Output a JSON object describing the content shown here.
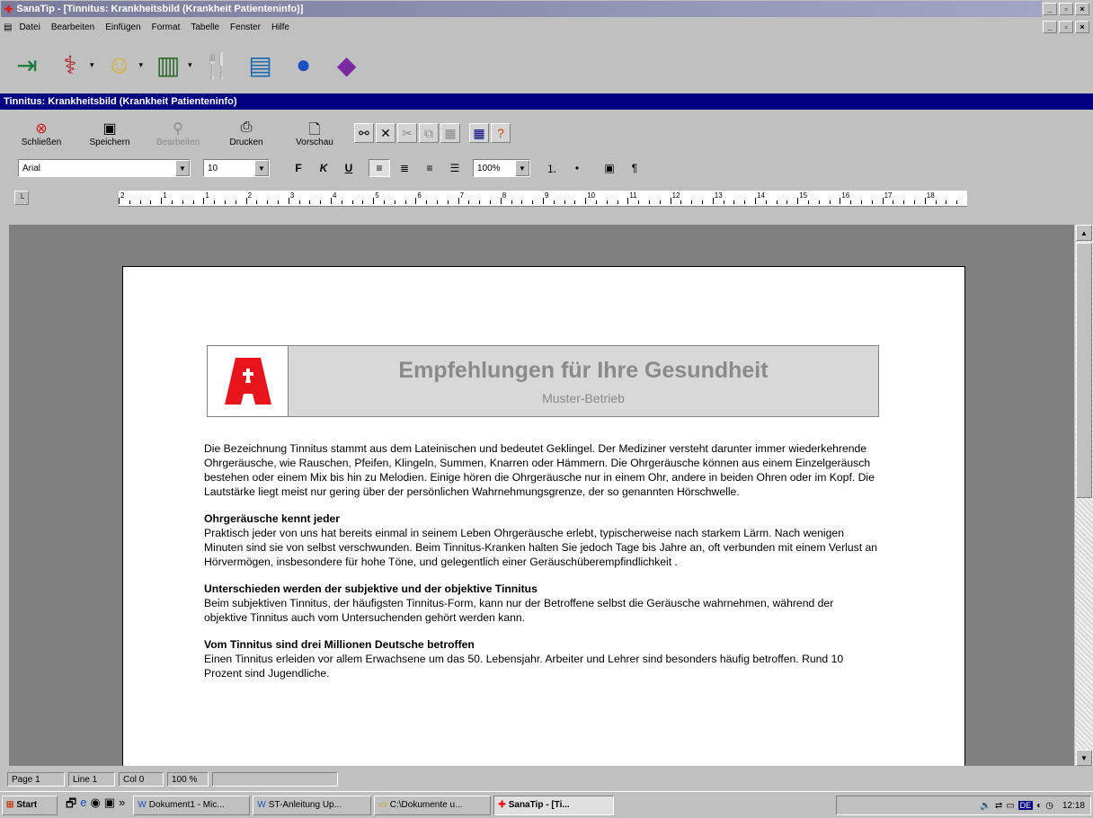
{
  "window": {
    "title": "SanaTip - [Tinnitus: Krankheitsbild (Krankheit Patienteninfo)]",
    "controls": [
      "_",
      "▫",
      "×"
    ]
  },
  "menu": [
    "Datei",
    "Bearbeiten",
    "Einfügen",
    "Format",
    "Tabelle",
    "Fenster",
    "Hilfe"
  ],
  "doc_window_title": "Tinnitus: Krankheitsbild (Krankheit Patienteninfo)",
  "toolbar": {
    "close": "Schließen",
    "save": "Speichern",
    "edit": "Bearbeiten",
    "print": "Drucken",
    "preview": "Vorschau"
  },
  "format": {
    "font": "Arial",
    "size": "10",
    "bold": "F",
    "italic": "K",
    "underline": "U",
    "zoom": "100%",
    "pilcrow": "¶"
  },
  "ruler": {
    "numbers": [
      "2",
      "1",
      "1",
      "2",
      "3",
      "4",
      "5",
      "6",
      "7",
      "8",
      "9",
      "10",
      "11",
      "12",
      "13",
      "14",
      "15",
      "16",
      "17",
      "18"
    ]
  },
  "banner": {
    "title": "Empfehlungen für Ihre Gesundheit",
    "subtitle": "Muster-Betrieb",
    "logo_color": "#e8141c"
  },
  "article": {
    "intro": "Die Bezeichnung Tinnitus stammt aus dem Lateinischen und bedeutet Geklingel. Der Mediziner versteht darunter immer wiederkehrende Ohrgeräusche, wie Rauschen, Pfeifen, Klingeln, Summen, Knarren oder Hämmern. Die Ohrgeräusche können aus einem Einzelgeräusch bestehen oder einem Mix bis hin zu Melodien. Einige hören die Ohrgeräusche nur in einem Ohr, andere in beiden Ohren oder im Kopf. Die Lautstärke liegt meist nur gering über der persönlichen Wahrnehmungsgrenze, der so genannten Hörschwelle.",
    "h1": "Ohrgeräusche kennt jeder",
    "p1": "Praktisch jeder von uns hat bereits einmal in seinem Leben Ohrgeräusche erlebt, typischerweise nach starkem Lärm. Nach wenigen Minuten sind sie von selbst verschwunden. Beim Tinnitus-Kranken halten Sie jedoch Tage bis Jahre an, oft verbunden mit einem Verlust an Hörvermögen, insbesondere für hohe Töne, und gelegentlich einer Geräuschüberempfindlichkeit .",
    "h2": "Unterschieden werden der subjektive und der objektive Tinnitus",
    "p2": "Beim subjektiven Tinnitus, der häufigsten Tinnitus-Form, kann nur der Betroffene selbst die Geräusche wahrnehmen, während der objektive Tinnitus auch vom Untersuchenden gehört werden kann.",
    "h3": "Vom Tinnitus sind drei Millionen Deutsche betroffen",
    "p3": "Einen Tinnitus erleiden vor allem Erwachsene um das 50. Lebensjahr. Arbeiter und Lehrer sind besonders häufig betroffen. Rund 10 Prozent sind Jugendliche."
  },
  "status": {
    "page": "Page 1",
    "line": "Line 1",
    "col": "Col 0",
    "zoom": "100 %"
  },
  "taskbar": {
    "start": "Start",
    "more": "»",
    "tasks": [
      "Dokument1 - Mic...",
      "ST-Anleitung Up...",
      "C:\\Dokumente u...",
      "SanaTip - [Ti..."
    ],
    "lang": "DE",
    "clock": "12:18"
  }
}
